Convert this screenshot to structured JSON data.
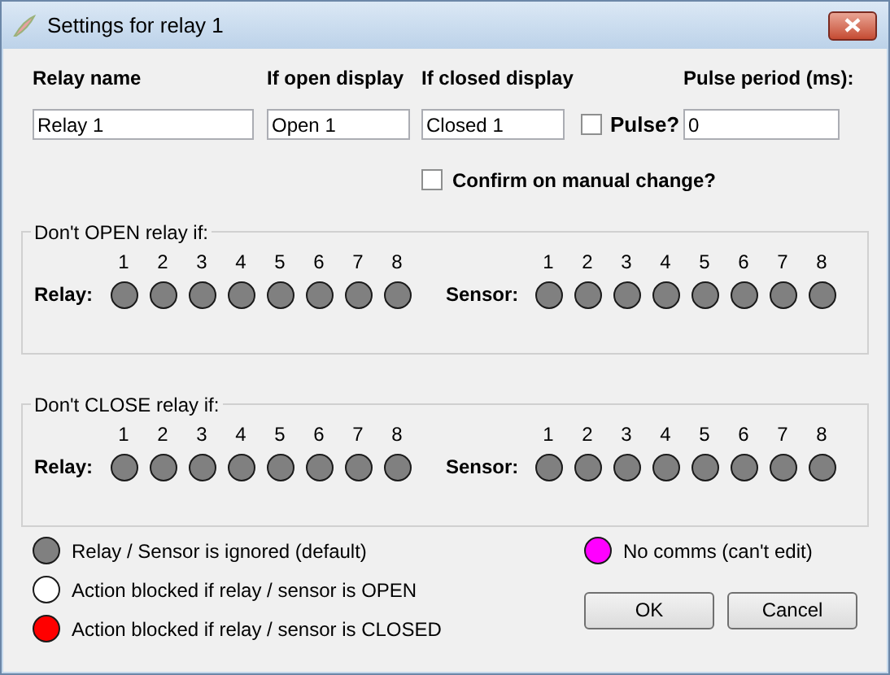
{
  "window": {
    "title": "Settings for relay 1"
  },
  "fields": [
    {
      "label": "Relay name",
      "value": "Relay 1"
    },
    {
      "label": "If open display",
      "value": "Open 1"
    },
    {
      "label": "If closed display",
      "value": "Closed 1"
    }
  ],
  "pulse": {
    "label": "Pulse?",
    "checked": false
  },
  "pulse_period": {
    "label": "Pulse period (ms):",
    "value": "0"
  },
  "confirm": {
    "label": "Confirm on manual change?",
    "checked": false
  },
  "groups": [
    {
      "title": "Don't OPEN relay if:",
      "relay_label": "Relay:",
      "sensor_label": "Sensor:",
      "relays": [
        {
          "number": "1",
          "color": "#808080"
        },
        {
          "number": "2",
          "color": "#808080"
        },
        {
          "number": "3",
          "color": "#808080"
        },
        {
          "number": "4",
          "color": "#808080"
        },
        {
          "number": "5",
          "color": "#808080"
        },
        {
          "number": "6",
          "color": "#808080"
        },
        {
          "number": "7",
          "color": "#808080"
        },
        {
          "number": "8",
          "color": "#808080"
        }
      ],
      "sensors": [
        {
          "number": "1",
          "color": "#808080"
        },
        {
          "number": "2",
          "color": "#808080"
        },
        {
          "number": "3",
          "color": "#808080"
        },
        {
          "number": "4",
          "color": "#808080"
        },
        {
          "number": "5",
          "color": "#808080"
        },
        {
          "number": "6",
          "color": "#808080"
        },
        {
          "number": "7",
          "color": "#808080"
        },
        {
          "number": "8",
          "color": "#808080"
        }
      ]
    },
    {
      "title": "Don't CLOSE relay if:",
      "relay_label": "Relay:",
      "sensor_label": "Sensor:",
      "relays": [
        {
          "number": "1",
          "color": "#808080"
        },
        {
          "number": "2",
          "color": "#808080"
        },
        {
          "number": "3",
          "color": "#808080"
        },
        {
          "number": "4",
          "color": "#808080"
        },
        {
          "number": "5",
          "color": "#808080"
        },
        {
          "number": "6",
          "color": "#808080"
        },
        {
          "number": "7",
          "color": "#808080"
        },
        {
          "number": "8",
          "color": "#808080"
        }
      ],
      "sensors": [
        {
          "number": "1",
          "color": "#808080"
        },
        {
          "number": "2",
          "color": "#808080"
        },
        {
          "number": "3",
          "color": "#808080"
        },
        {
          "number": "4",
          "color": "#808080"
        },
        {
          "number": "5",
          "color": "#808080"
        },
        {
          "number": "6",
          "color": "#808080"
        },
        {
          "number": "7",
          "color": "#808080"
        },
        {
          "number": "8",
          "color": "#808080"
        }
      ]
    }
  ],
  "legend": [
    {
      "text": "Relay / Sensor is ignored (default)",
      "color": "#808080"
    },
    {
      "text": "Action blocked if relay / sensor is OPEN",
      "color": "#ffffff"
    },
    {
      "text": "Action blocked if relay / sensor is CLOSED",
      "color": "#ff0000"
    },
    {
      "text": "No comms (can't edit)",
      "color": "#ff00ff"
    }
  ],
  "buttons": [
    "OK",
    "Cancel"
  ]
}
